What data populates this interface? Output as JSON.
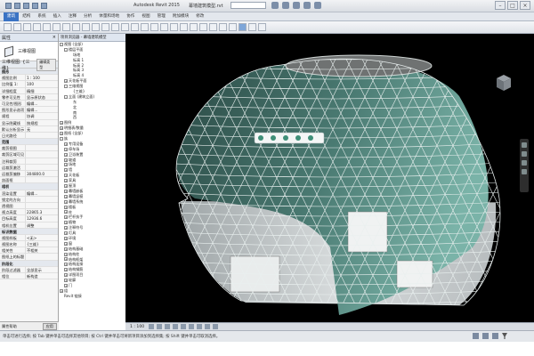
{
  "window": {
    "app_title": "Autodesk Revit 2015",
    "doc_title": "幕墙建筑模型.rvt"
  },
  "ribbon": {
    "tabs": [
      "建筑",
      "结构",
      "系统",
      "插入",
      "注释",
      "分析",
      "体量和场地",
      "协作",
      "视图",
      "管理",
      "附加模块",
      "修改"
    ],
    "active_tab_index": 0
  },
  "properties": {
    "header": "属性",
    "type_name": "三维视图",
    "type_selector": "三维视图: {三维}",
    "edit_type_label": "编辑类型",
    "rows": [
      {
        "k": "图形",
        "v": "",
        "group": true
      },
      {
        "k": "视图比例",
        "v": "1 : 100"
      },
      {
        "k": "比例值 1:",
        "v": "100"
      },
      {
        "k": "详细程度",
        "v": "精细"
      },
      {
        "k": "零件可见性",
        "v": "显示原状态"
      },
      {
        "k": "可见性/图形",
        "v": "编辑..."
      },
      {
        "k": "图形显示选项",
        "v": "编辑..."
      },
      {
        "k": "规程",
        "v": "协调"
      },
      {
        "k": "显示隐藏线",
        "v": "按规程"
      },
      {
        "k": "默认分析显示",
        "v": "无"
      },
      {
        "k": "日光路径",
        "v": ""
      },
      {
        "k": "范围",
        "v": "",
        "group": true
      },
      {
        "k": "裁剪视图",
        "v": ""
      },
      {
        "k": "裁剪区域可见",
        "v": ""
      },
      {
        "k": "注释裁剪",
        "v": ""
      },
      {
        "k": "远裁剪激活",
        "v": ""
      },
      {
        "k": "远裁剪偏移",
        "v": "304800.0"
      },
      {
        "k": "剖面框",
        "v": ""
      },
      {
        "k": "相机",
        "v": "",
        "group": true
      },
      {
        "k": "渲染设置",
        "v": "编辑..."
      },
      {
        "k": "锁定的方向",
        "v": ""
      },
      {
        "k": "透视图",
        "v": ""
      },
      {
        "k": "视点高度",
        "v": "22865.3"
      },
      {
        "k": "目标高度",
        "v": "12936.6"
      },
      {
        "k": "相机位置",
        "v": "调整"
      },
      {
        "k": "标识数据",
        "v": "",
        "group": true
      },
      {
        "k": "视图样板",
        "v": "<无>"
      },
      {
        "k": "视图名称",
        "v": "{三维}"
      },
      {
        "k": "相关性",
        "v": "不相关"
      },
      {
        "k": "图纸上的标题",
        "v": ""
      },
      {
        "k": "阶段化",
        "v": "",
        "group": true
      },
      {
        "k": "阶段过滤器",
        "v": "全部显示"
      },
      {
        "k": "相位",
        "v": "新构造"
      }
    ],
    "help_link": "属性帮助",
    "apply_label": "应用"
  },
  "browser": {
    "header": "项目浏览器 - 幕墙建筑模型",
    "items": [
      {
        "label": "视图 (全部)",
        "level": 0,
        "toggle": "-"
      },
      {
        "label": "楼层平面",
        "level": 1,
        "toggle": "-"
      },
      {
        "label": "场地",
        "level": 2
      },
      {
        "label": "标高 1",
        "level": 2
      },
      {
        "label": "标高 2",
        "level": 2
      },
      {
        "label": "标高 3",
        "level": 2
      },
      {
        "label": "标高 4",
        "level": 2
      },
      {
        "label": "天花板平面",
        "level": 1,
        "toggle": "+"
      },
      {
        "label": "三维视图",
        "level": 1,
        "toggle": "-"
      },
      {
        "label": "{三维}",
        "level": 2
      },
      {
        "label": "立面 (建筑立面)",
        "level": 1,
        "toggle": "-"
      },
      {
        "label": "东",
        "level": 2
      },
      {
        "label": "北",
        "level": 2
      },
      {
        "label": "南",
        "level": 2
      },
      {
        "label": "西",
        "level": 2
      },
      {
        "label": "图例",
        "level": 0,
        "toggle": "+"
      },
      {
        "label": "明细表/数量",
        "level": 0,
        "toggle": "+"
      },
      {
        "label": "图纸 (全部)",
        "level": 0,
        "toggle": "+"
      },
      {
        "label": "族",
        "level": 0,
        "toggle": "-"
      },
      {
        "label": "专用设备",
        "level": 1,
        "toggle": "+"
      },
      {
        "label": "停车场",
        "level": 1,
        "toggle": "+"
      },
      {
        "label": "卫浴装置",
        "level": 1,
        "toggle": "+"
      },
      {
        "label": "坡道",
        "level": 1,
        "toggle": "+"
      },
      {
        "label": "场地",
        "level": 1,
        "toggle": "+"
      },
      {
        "label": "墙",
        "level": 1,
        "toggle": "+"
      },
      {
        "label": "天花板",
        "level": 1,
        "toggle": "+"
      },
      {
        "label": "家具",
        "level": 1,
        "toggle": "+"
      },
      {
        "label": "屋顶",
        "level": 1,
        "toggle": "+"
      },
      {
        "label": "幕墙嵌板",
        "level": 1,
        "toggle": "+"
      },
      {
        "label": "幕墙竖梃",
        "level": 1,
        "toggle": "+"
      },
      {
        "label": "幕墙系统",
        "level": 1,
        "toggle": "+"
      },
      {
        "label": "楼板",
        "level": 1,
        "toggle": "+"
      },
      {
        "label": "柱",
        "level": 1,
        "toggle": "+"
      },
      {
        "label": "栏杆扶手",
        "level": 1,
        "toggle": "+"
      },
      {
        "label": "植物",
        "level": 1,
        "toggle": "+"
      },
      {
        "label": "注释符号",
        "level": 1,
        "toggle": "+"
      },
      {
        "label": "灯具",
        "level": 1,
        "toggle": "+"
      },
      {
        "label": "环境",
        "level": 1,
        "toggle": "+"
      },
      {
        "label": "窗",
        "level": 1,
        "toggle": "+"
      },
      {
        "label": "结构基础",
        "level": 1,
        "toggle": "+"
      },
      {
        "label": "结构柱",
        "level": 1,
        "toggle": "+"
      },
      {
        "label": "结构框架",
        "level": 1,
        "toggle": "+"
      },
      {
        "label": "结构连接",
        "level": 1,
        "toggle": "+"
      },
      {
        "label": "结构钢筋",
        "level": 1,
        "toggle": "+"
      },
      {
        "label": "详图项目",
        "level": 1,
        "toggle": "+"
      },
      {
        "label": "轮廓",
        "level": 1,
        "toggle": "+"
      },
      {
        "label": "门",
        "level": 1,
        "toggle": "+"
      },
      {
        "label": "组",
        "level": 0,
        "toggle": "+"
      },
      {
        "label": "Revit 链接",
        "level": 0,
        "toggle": ""
      }
    ]
  },
  "viewport": {
    "scale_label": "1 : 100"
  },
  "statusbar": {
    "text": "单击可进行选择; 按 Tab 键并单击可选择其他项目; 按 Ctrl 键并单击可将新项目添加到选择集; 按 Shift 键并单击可取消选择。"
  }
}
